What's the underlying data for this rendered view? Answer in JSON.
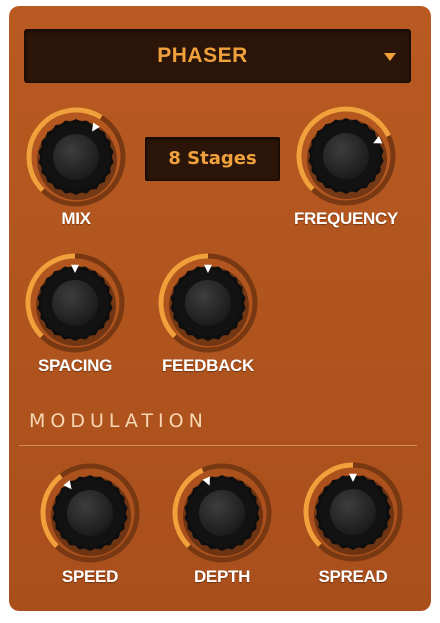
{
  "header": {
    "title": "PHASER",
    "dropdown_icon": "triangle-down-icon"
  },
  "stages": {
    "value": "8 Stages"
  },
  "knobs": [
    {
      "id": "mix",
      "label": "MIX",
      "value": 0.62
    },
    {
      "id": "frequency",
      "label": "FREQUENCY",
      "value": 0.74
    },
    {
      "id": "spacing",
      "label": "SPACING",
      "value": 0.5
    },
    {
      "id": "feedback",
      "label": "FEEDBACK",
      "value": 0.5
    },
    {
      "id": "speed",
      "label": "SPEED",
      "value": 0.36
    },
    {
      "id": "depth",
      "label": "DEPTH",
      "value": 0.41
    },
    {
      "id": "spread",
      "label": "SPREAD",
      "value": 0.5
    }
  ],
  "modulation": {
    "title": "MODULATION"
  },
  "colors": {
    "panel": "#b2561f",
    "panel_dark": "#97451a",
    "accent": "#f0a13c",
    "display_bg": "#2b1408",
    "knob_body": "#2a2a2a",
    "track": "#6e3411",
    "pointer": "#ffffff"
  }
}
